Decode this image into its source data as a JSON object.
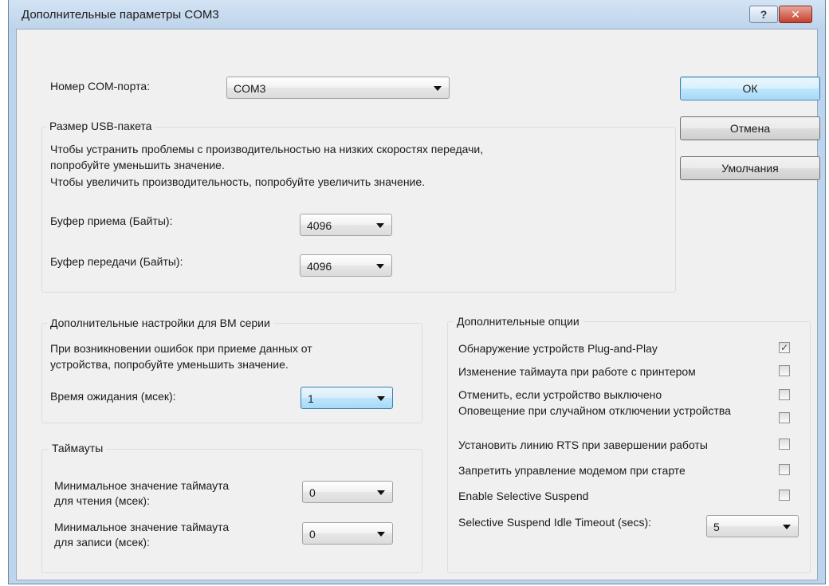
{
  "window": {
    "title": "Дополнительные параметры COM3",
    "help_glyph": "?",
    "close_glyph": "✕"
  },
  "port": {
    "label": "Номер COM-порта:",
    "value": "COM3"
  },
  "buttons": {
    "ok": "ОК",
    "cancel": "Отмена",
    "defaults": "Умолчания"
  },
  "usb": {
    "title": "Размер USB-пакета",
    "desc_line1": "Чтобы устранить проблемы с производительностью на низких скоростях передачи,",
    "desc_line2": "попробуйте уменьшить значение.",
    "desc_line3": "Чтобы увеличить производительность, попробуйте увеличить значение.",
    "rx_label": "Буфер приема (Байты):",
    "rx_value": "4096",
    "tx_label": "Буфер передачи (Байты):",
    "tx_value": "4096"
  },
  "bm": {
    "title": "Дополнительные настройки для BM серии",
    "desc_line1": "При возникновении ошибок при приеме данных от",
    "desc_line2": "устройства, попробуйте уменьшить значение.",
    "latency_label": "Время ожидания (мсек):",
    "latency_value": "1"
  },
  "timeouts": {
    "title": "Таймауты",
    "read_label_line1": "Минимальное значение таймаута",
    "read_label_line2": "для чтения (мсек):",
    "read_value": "0",
    "write_label_line1": "Минимальное значение таймаута",
    "write_label_line2": "для записи (мсек):",
    "write_value": "0"
  },
  "options": {
    "title": "Дополнительные опции",
    "items": [
      {
        "label": "Обнаружение устройств Plug-and-Play",
        "checked": true
      },
      {
        "label": "Изменение таймаута при работе с принтером",
        "checked": false
      },
      {
        "label": "Отменить, если устройство выключено",
        "checked": false
      },
      {
        "label": "Оповещение при случайном отключении устройства",
        "checked": false
      },
      {
        "label": "Установить линию RTS при завершении работы",
        "checked": false
      },
      {
        "label": "Запретить управление модемом при старте",
        "checked": false
      },
      {
        "label": "Enable Selective Suspend",
        "checked": false
      }
    ],
    "check_glyph": "✓",
    "idle_label": "Selective Suspend Idle Timeout (secs):",
    "idle_value": "5"
  }
}
